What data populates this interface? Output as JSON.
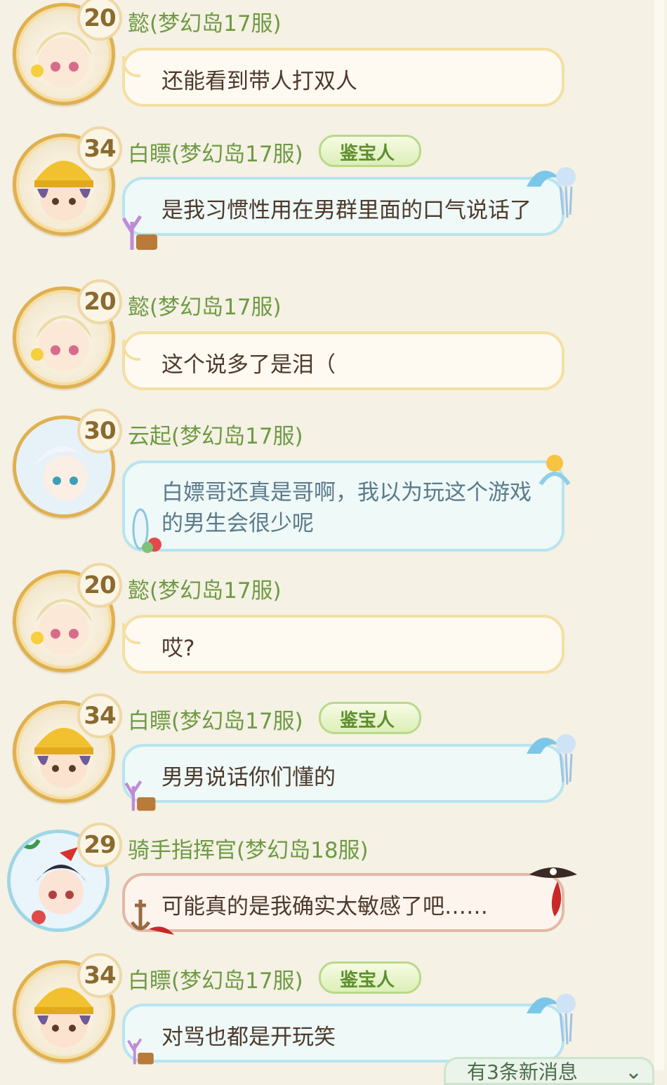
{
  "badge_label": "鉴宝人",
  "messages": [
    {
      "level": "20",
      "name": "懿(梦幻岛17服)",
      "text": "还能看到带人打双人"
    },
    {
      "level": "34",
      "name": "白瞟(梦幻岛17服)",
      "text": "是我习惯性用在男群里面的口气说话了"
    },
    {
      "level": "20",
      "name": "懿(梦幻岛17服)",
      "text": "这个说多了是泪（"
    },
    {
      "level": "30",
      "name": "云起(梦幻岛17服)",
      "text": "白嫖哥还真是哥啊，我以为玩这个游戏的男生会很少呢"
    },
    {
      "level": "20",
      "name": "懿(梦幻岛17服)",
      "text": "哎?"
    },
    {
      "level": "34",
      "name": "白瞟(梦幻岛17服)",
      "text": "男男说话你们懂的"
    },
    {
      "level": "29",
      "name": "骑手指挥官(梦幻岛18服)",
      "text": "可能真的是我确实太敏感了吧……"
    },
    {
      "level": "34",
      "name": "白瞟(梦幻岛17服)",
      "text": "对骂也都是开玩笑"
    }
  ],
  "new_message_notice": "有3条新消息",
  "colors": {
    "background": "#f5f1e4",
    "name": "#6f9a44",
    "level": "#8a6a2e",
    "bubble_border": "#f4dfa3"
  }
}
